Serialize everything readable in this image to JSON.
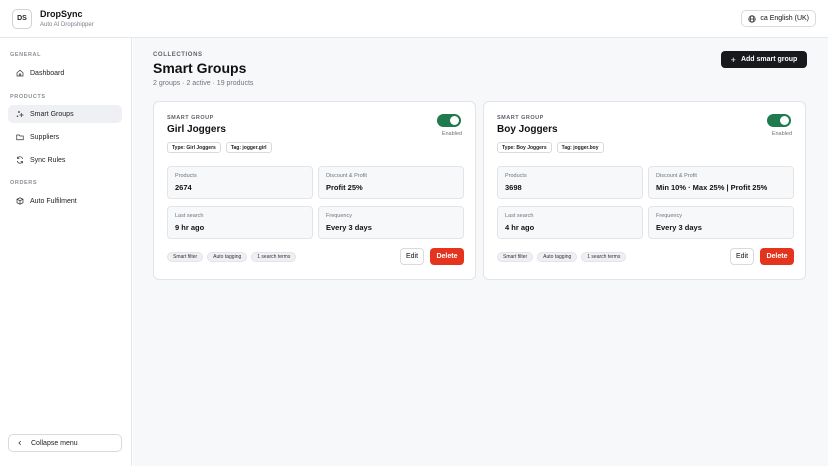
{
  "header": {
    "logo_text": "DS",
    "app_name": "DropSync",
    "app_tagline": "Auto AI Dropshipper",
    "language_label": "English (UK)",
    "language_prefix": "ca"
  },
  "sidebar": {
    "sections": [
      {
        "title": "GENERAL",
        "items": [
          {
            "label": "Dashboard",
            "icon": "home-icon"
          }
        ]
      },
      {
        "title": "PRODUCTS",
        "items": [
          {
            "label": "Smart Groups",
            "icon": "sparkles-icon",
            "active": true
          },
          {
            "label": "Suppliers",
            "icon": "folder-icon"
          },
          {
            "label": "Sync Rules",
            "icon": "refresh-icon"
          }
        ]
      },
      {
        "title": "ORDERS",
        "items": [
          {
            "label": "Auto Fulfilment",
            "icon": "package-icon"
          }
        ]
      }
    ],
    "collapse_label": "Collapse menu"
  },
  "main": {
    "breadcrumb": "COLLECTIONS",
    "title": "Smart Groups",
    "summary": "2 groups · 2 active · 19 products",
    "add_button": "Add smart group",
    "cards": [
      {
        "label": "SMART GROUP",
        "title": "Girl Joggers",
        "enabled": true,
        "enabled_label": "Enabled",
        "tags": [
          "Type: Girl Joggers",
          "Tag: jogger.girl"
        ],
        "stats": [
          {
            "label": "Products",
            "value": "2674"
          },
          {
            "label": "Discount & Profit",
            "value": "Profit 25%"
          },
          {
            "label": "Last search",
            "value": "9 hr ago"
          },
          {
            "label": "Frequency",
            "value": "Every 3 days"
          }
        ],
        "chips": [
          "Smart filter",
          "Auto tagging",
          "1 search terms"
        ],
        "edit_label": "Edit",
        "delete_label": "Delete"
      },
      {
        "label": "SMART GROUP",
        "title": "Boy Joggers",
        "enabled": true,
        "enabled_label": "Enabled",
        "tags": [
          "Type: Boy Joggers",
          "Tag: jogger.boy"
        ],
        "stats": [
          {
            "label": "Products",
            "value": "3698"
          },
          {
            "label": "Discount & Profit",
            "value": "Min 10% · Max 25% | Profit 25%"
          },
          {
            "label": "Last search",
            "value": "4 hr ago"
          },
          {
            "label": "Frequency",
            "value": "Every 3 days"
          }
        ],
        "chips": [
          "Smart filter",
          "Auto tagging",
          "1 search terms"
        ],
        "edit_label": "Edit",
        "delete_label": "Delete"
      }
    ]
  },
  "colors": {
    "primary_dark": "#18191c",
    "toggle_on": "#1f7a4d",
    "danger": "#e5341d",
    "active_nav_bg": "#eef0f3"
  }
}
